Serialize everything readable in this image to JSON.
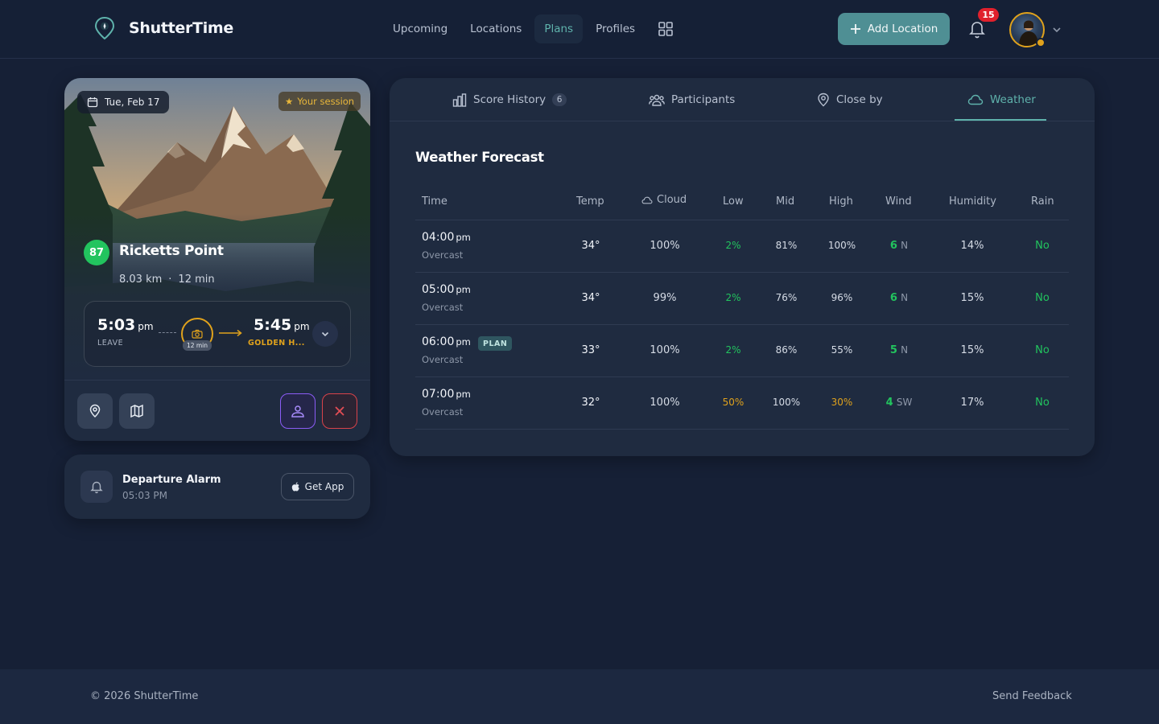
{
  "header": {
    "brand": "ShutterTime",
    "nav": [
      {
        "label": "Upcoming"
      },
      {
        "label": "Locations"
      },
      {
        "label": "Plans",
        "active": true
      },
      {
        "label": "Profiles"
      }
    ],
    "add_location_label": "Add Location",
    "notification_count": "15"
  },
  "location_card": {
    "date": "Tue, Feb 17",
    "session_label": "Your session",
    "score": "87",
    "name": "Ricketts Point",
    "distance": "8.03 km",
    "separator": "·",
    "drive_time": "12 min",
    "leave_time": "5:03",
    "leave_suffix": "pm",
    "leave_label": "LEAVE",
    "travel_badge": "12 min",
    "golden_time": "5:45",
    "golden_suffix": "pm",
    "golden_label": "GOLDEN H..."
  },
  "alarm": {
    "title": "Departure Alarm",
    "time": "05:03 PM",
    "get_app_label": "Get App"
  },
  "tabs": [
    {
      "label": "Score History",
      "count": "6"
    },
    {
      "label": "Participants"
    },
    {
      "label": "Close by"
    },
    {
      "label": "Weather",
      "active": true
    }
  ],
  "weather": {
    "title": "Weather Forecast",
    "columns": [
      "Time",
      "Temp",
      "Cloud",
      "Low",
      "Mid",
      "High",
      "Wind",
      "Humidity",
      "Rain"
    ],
    "rows": [
      {
        "time": "04:00",
        "suffix": "pm",
        "cond": "Overcast",
        "plan": "",
        "temp": "34°",
        "cloud": "100%",
        "low": "2%",
        "mid": "81%",
        "high": "100%",
        "wind": "6",
        "dir": "N",
        "humidity": "14%",
        "rain": "No"
      },
      {
        "time": "05:00",
        "suffix": "pm",
        "cond": "Overcast",
        "plan": "",
        "temp": "34°",
        "cloud": "99%",
        "low": "2%",
        "mid": "76%",
        "high": "96%",
        "wind": "6",
        "dir": "N",
        "humidity": "15%",
        "rain": "No"
      },
      {
        "time": "06:00",
        "suffix": "pm",
        "cond": "Overcast",
        "plan": "PLAN",
        "temp": "33°",
        "cloud": "100%",
        "low": "2%",
        "mid": "86%",
        "high": "55%",
        "wind": "5",
        "dir": "N",
        "humidity": "15%",
        "rain": "No"
      },
      {
        "time": "07:00",
        "suffix": "pm",
        "cond": "Overcast",
        "plan": "",
        "temp": "32°",
        "cloud": "100%",
        "low": "50%",
        "mid": "100%",
        "high": "30%",
        "wind": "4",
        "dir": "SW",
        "humidity": "17%",
        "rain": "No"
      }
    ]
  },
  "footer": {
    "copyright": "© 2026 ShutterTime",
    "feedback": "Send Feedback"
  },
  "colors": {
    "accent": "#5fb3ac",
    "score_green": "#22c45e",
    "golden": "#e0a21c",
    "danger": "#d9434a",
    "purple": "#8b5cf6"
  }
}
